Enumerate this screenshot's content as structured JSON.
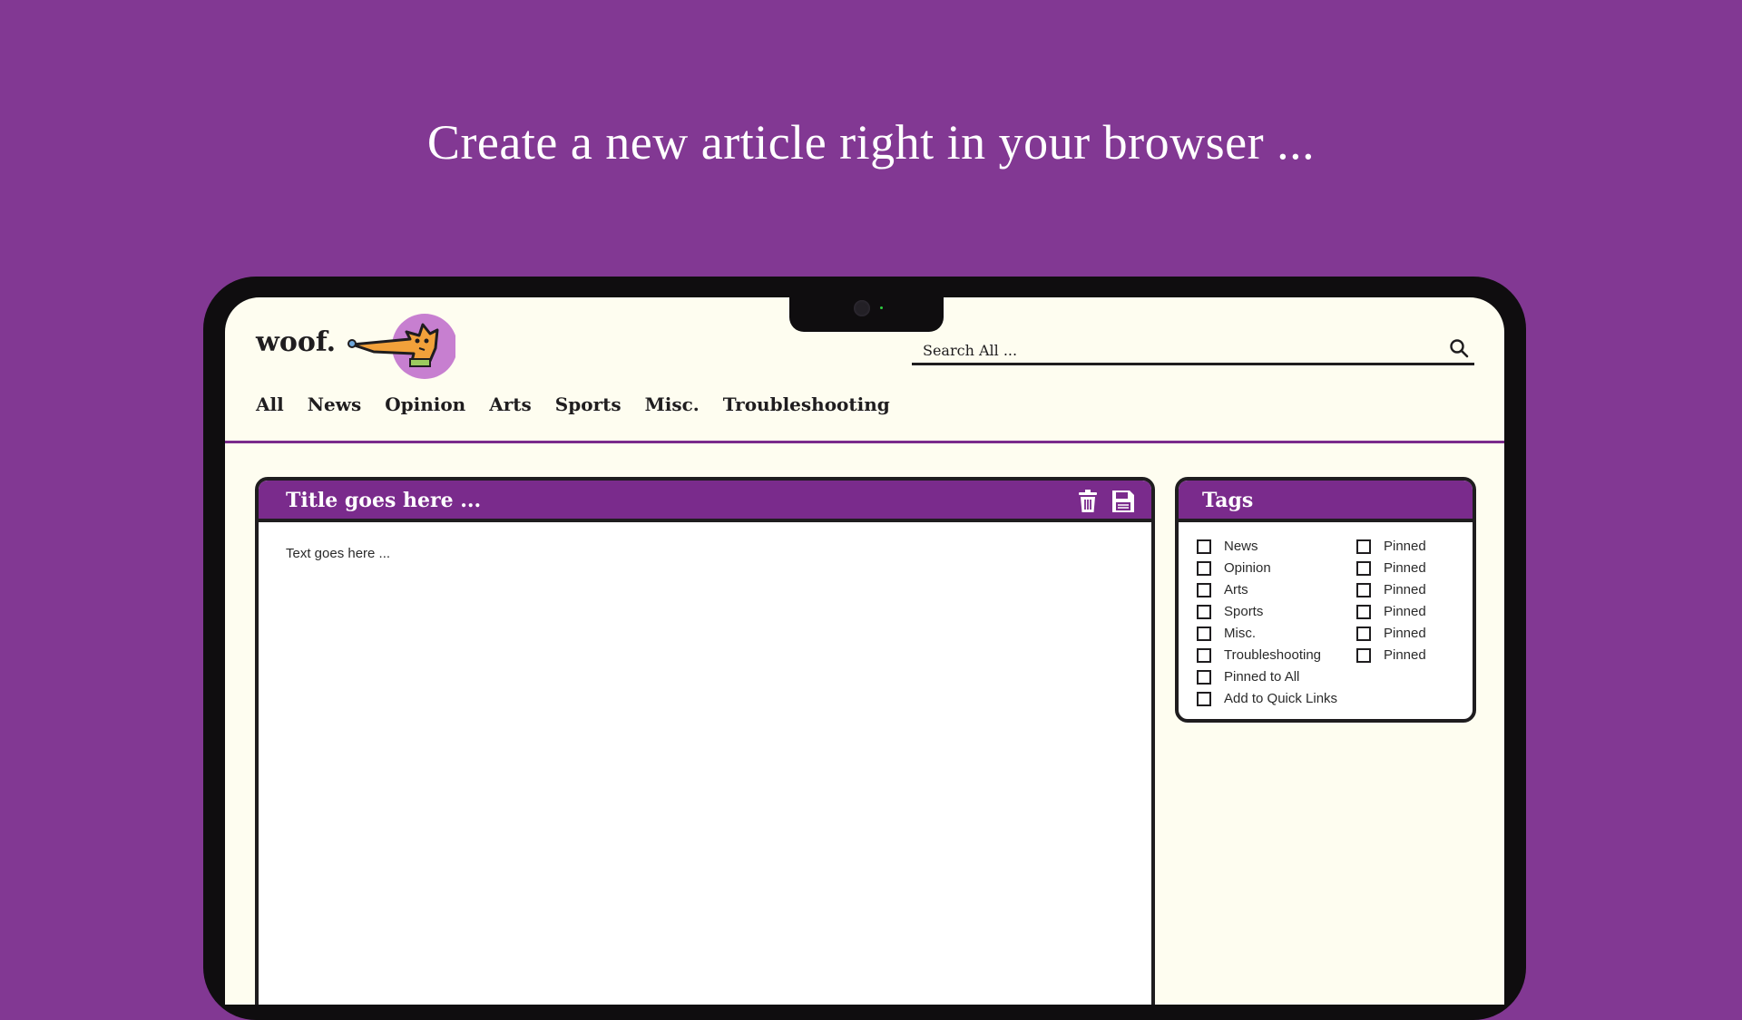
{
  "headline": "Create a new article right in your browser ...",
  "colors": {
    "background": "#823893",
    "accent": "#7a2b8c",
    "screen": "#fefdf0",
    "ink": "#1f1d1f"
  },
  "app": {
    "logo_text": "woof.",
    "search": {
      "placeholder": "Search All ..."
    },
    "nav": [
      "All",
      "News",
      "Opinion",
      "Arts",
      "Sports",
      "Misc.",
      "Troubleshooting"
    ]
  },
  "editor": {
    "title_placeholder": "Title goes here ...",
    "body_placeholder": "Text goes here ...",
    "icons": [
      "trash-icon",
      "save-icon"
    ]
  },
  "tags": {
    "title": "Tags",
    "categories": [
      {
        "label": "News",
        "pinned_label": "Pinned",
        "checked": false,
        "pinned": false
      },
      {
        "label": "Opinion",
        "pinned_label": "Pinned",
        "checked": false,
        "pinned": false
      },
      {
        "label": "Arts",
        "pinned_label": "Pinned",
        "checked": false,
        "pinned": false
      },
      {
        "label": "Sports",
        "pinned_label": "Pinned",
        "checked": false,
        "pinned": false
      },
      {
        "label": "Misc.",
        "pinned_label": "Pinned",
        "checked": false,
        "pinned": false
      },
      {
        "label": "Troubleshooting",
        "pinned_label": "Pinned",
        "checked": false,
        "pinned": false
      }
    ],
    "extra": [
      {
        "label": "Pinned to All",
        "checked": false
      },
      {
        "label": "Add to Quick Links",
        "checked": false
      }
    ]
  }
}
